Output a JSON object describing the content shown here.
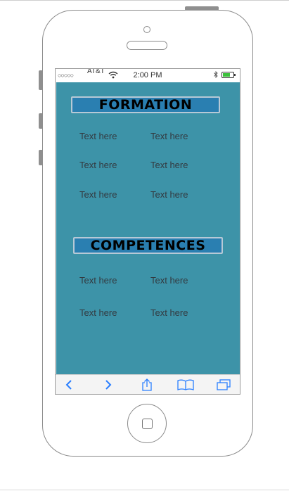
{
  "status_bar": {
    "signal": "○○○○○",
    "carrier": "AT&T",
    "time": "2:00 PM",
    "wifi_icon": "wifi-icon",
    "bluetooth_icon": "bluetooth-icon",
    "battery_icon": "battery-icon",
    "battery_level": 0.7
  },
  "sections": [
    {
      "title": "FORMATION",
      "rows": [
        [
          "Text here",
          "Text here"
        ],
        [
          "Text here",
          "Text here"
        ],
        [
          "Text here",
          "Text here"
        ]
      ]
    },
    {
      "title": "COMPETENCES",
      "rows": [
        [
          "Text here",
          "Text here"
        ],
        [
          "Text here",
          "Text here"
        ]
      ]
    }
  ],
  "toolbar": {
    "items": [
      "back-icon",
      "forward-icon",
      "share-icon",
      "bookmarks-icon",
      "tabs-icon"
    ]
  },
  "colors": {
    "content_bg": "#3d93a8",
    "title_bg": "#2a7fb1",
    "accent": "#2a7fff"
  }
}
